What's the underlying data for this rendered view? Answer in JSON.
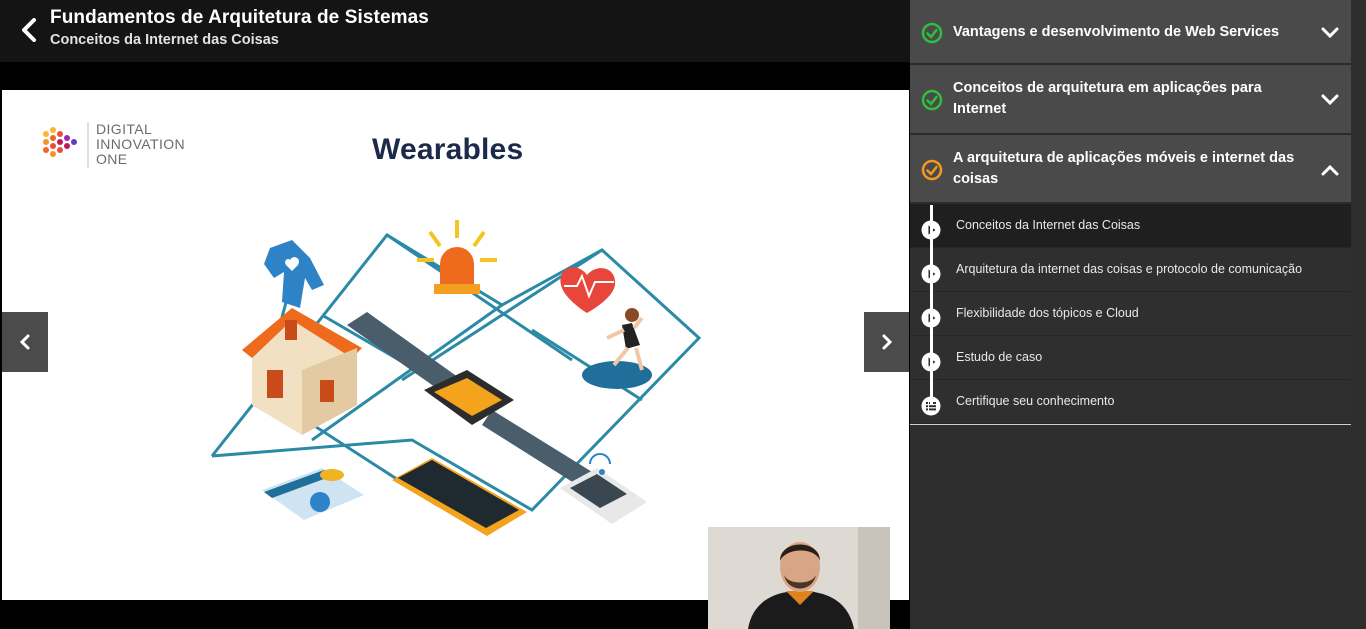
{
  "header": {
    "course_title": "Fundamentos de Arquitetura de Sistemas",
    "lesson_subtitle": "Conceitos da Internet das Coisas"
  },
  "slide": {
    "logo_lines": [
      "DIGITAL",
      "INNOVATION",
      "ONE"
    ],
    "title": "Wearables"
  },
  "sidebar": {
    "modules": [
      {
        "title": "Vantagens e desenvolvimento de Web Services",
        "status": "completed",
        "expanded": false
      },
      {
        "title": "Conceitos de arquitetura em aplicações para Internet",
        "status": "completed",
        "expanded": false
      },
      {
        "title": "A arquitetura de aplicações móveis e internet das coisas",
        "status": "in-progress",
        "expanded": true
      }
    ],
    "lessons": [
      {
        "label": "Conceitos da Internet das Coisas",
        "type": "video",
        "active": true
      },
      {
        "label": "Arquitetura da internet das coisas e protocolo de comunicação",
        "type": "video",
        "active": false
      },
      {
        "label": "Flexibilidade dos tópicos e Cloud",
        "type": "video",
        "active": false
      },
      {
        "label": "Estudo de caso",
        "type": "video",
        "active": false
      },
      {
        "label": "Certifique seu conhecimento",
        "type": "quiz",
        "active": false
      }
    ]
  },
  "colors": {
    "completed": "#2fbe3f",
    "in_progress": "#f39a1f",
    "header_bg": "#141414",
    "module_bg": "#4a4a4a",
    "lesson_bg": "#2f2f2f"
  }
}
